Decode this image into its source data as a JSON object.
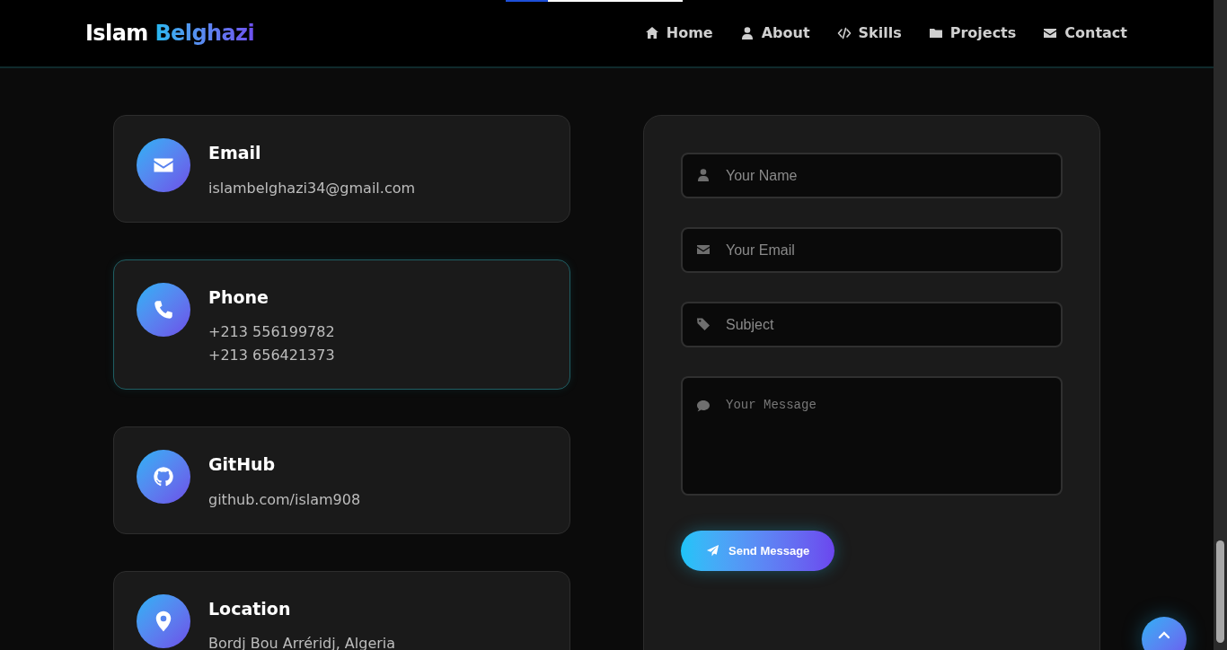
{
  "progress": {
    "level": 0.24
  },
  "brand": {
    "first": "Islam",
    "second": "Belghazi"
  },
  "nav": [
    {
      "label": "Home"
    },
    {
      "label": "About"
    },
    {
      "label": "Skills"
    },
    {
      "label": "Projects"
    },
    {
      "label": "Contact"
    }
  ],
  "contact_cards": [
    {
      "title": "Email",
      "lines": [
        "islambelghazi34@gmail.com"
      ],
      "highlighted": false
    },
    {
      "title": "Phone",
      "lines": [
        "+213 556199782",
        "+213 656421373"
      ],
      "highlighted": true
    },
    {
      "title": "GitHub",
      "lines": [
        "github.com/islam908"
      ],
      "highlighted": false
    },
    {
      "title": "Location",
      "lines": [
        "Bordj Bou Arréridj, Algeria"
      ],
      "highlighted": false
    }
  ],
  "form": {
    "fields": [
      {
        "kind": "input",
        "placeholder": "Your Name"
      },
      {
        "kind": "input",
        "placeholder": "Your Email"
      },
      {
        "kind": "input",
        "placeholder": "Subject"
      },
      {
        "kind": "textarea",
        "placeholder": "Your Message"
      }
    ],
    "submit": "Send Message"
  }
}
